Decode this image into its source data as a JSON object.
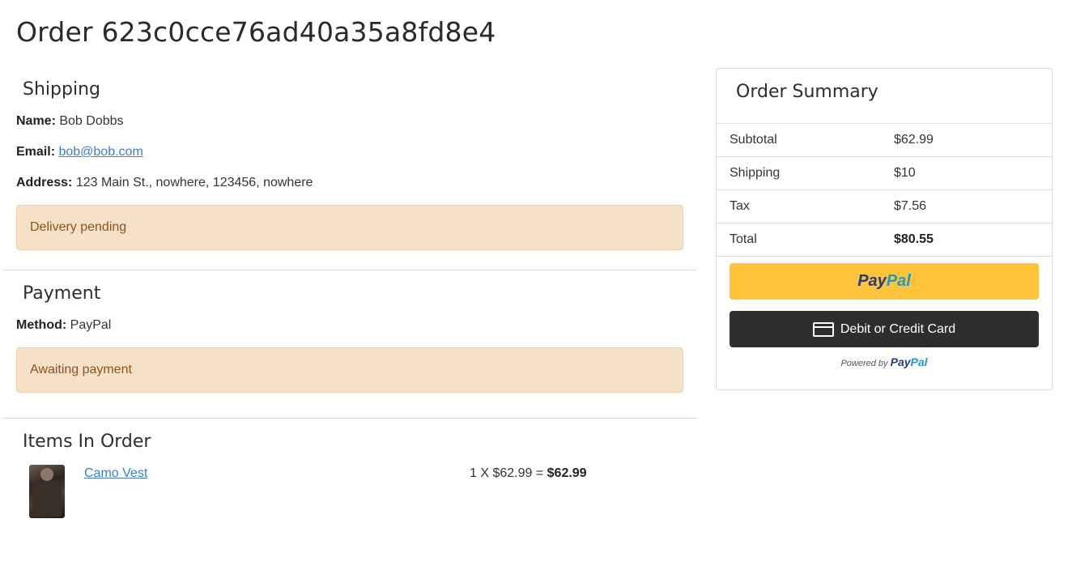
{
  "page": {
    "title": "Order 623c0cce76ad40a35a8fd8e4"
  },
  "shipping": {
    "heading": "Shipping",
    "name_label": "Name:",
    "name_value": "Bob Dobbs",
    "email_label": "Email:",
    "email_value": "bob@bob.com",
    "address_label": "Address:",
    "address_value": "123 Main St., nowhere, 123456, nowhere",
    "status": "Delivery pending"
  },
  "payment": {
    "heading": "Payment",
    "method_label": "Method:",
    "method_value": "PayPal",
    "status": "Awaiting payment"
  },
  "items": {
    "heading": "Items In Order",
    "list": [
      {
        "name": "Camo Vest",
        "qty_price": "1 X $62.99 =",
        "line_total": "$62.99"
      }
    ]
  },
  "summary": {
    "heading": "Order Summary",
    "rows": [
      {
        "label": "Subtotal",
        "value": "$62.99"
      },
      {
        "label": "Shipping",
        "value": "$10"
      },
      {
        "label": "Tax",
        "value": "$7.56"
      },
      {
        "label": "Total",
        "value": "$80.55"
      }
    ],
    "paypal_button": {
      "part1": "Pay",
      "part2": "Pal"
    },
    "card_button_label": "Debit or Credit Card",
    "powered_by": {
      "prefix": "Powered by",
      "part1": "Pay",
      "part2": "Pal"
    }
  },
  "colors": {
    "alert_bg": "#f5e1c8",
    "alert_text": "#8a5320",
    "link": "#3b7ddd",
    "paypal_yellow": "#ffc439",
    "paypal_dark_blue": "#253b80",
    "paypal_light_blue": "#179bd7",
    "card_button": "#2c2e2f"
  },
  "icons": {
    "card": "credit-card-icon"
  }
}
